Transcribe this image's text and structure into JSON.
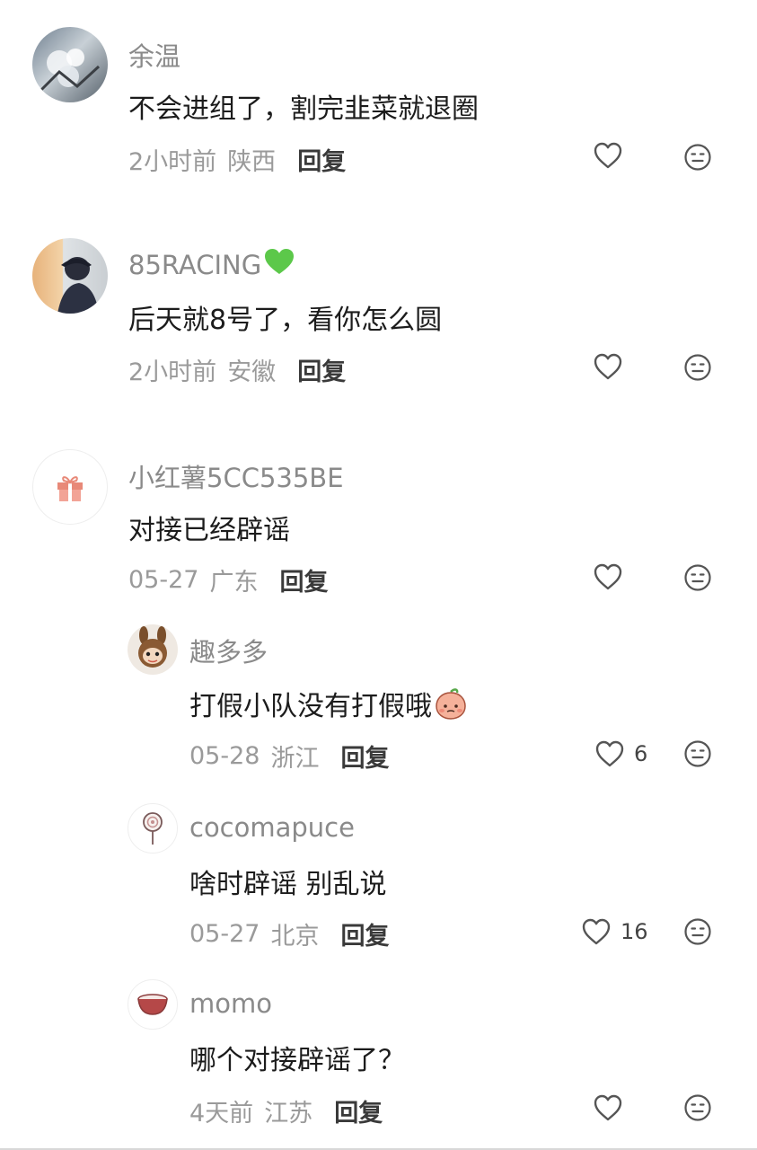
{
  "comments": [
    {
      "username": "余温",
      "content": "不会进组了，割完韭菜就退圈",
      "time": "2小时前",
      "location": "陕西",
      "reply": "回复"
    },
    {
      "username": "85RACING",
      "content": "后天就8号了，看你怎么圆",
      "time": "2小时前",
      "location": "安徽",
      "reply": "回复"
    },
    {
      "username": "小红薯5CC535BE",
      "content": "对接已经辟谣",
      "time": "05-27",
      "location": "广东",
      "reply": "回复"
    }
  ],
  "replies": [
    {
      "username": "趣多多",
      "content": "打假小队没有打假哦",
      "time": "05-28",
      "location": "浙江",
      "reply": "回复",
      "likes": "6"
    },
    {
      "username": "cocomapuce",
      "content": "啥时辟谣 别乱说",
      "time": "05-27",
      "location": "北京",
      "reply": "回复",
      "likes": "16"
    },
    {
      "username": "momo",
      "content": "哪个对接辟谣了？",
      "time": "4天前",
      "location": "江苏",
      "reply": "回复"
    }
  ],
  "icons": {
    "like": "heart-outline-icon",
    "react": "neutral-face-icon",
    "badge": "green-heart-icon",
    "inline_emoji": "peach-face-icon"
  },
  "colors": {
    "username": "#8a8a8a",
    "content": "#1c1c1c",
    "meta": "#9a9a9a",
    "reply": "#3a3a3a",
    "badge": "#5cc84a"
  }
}
